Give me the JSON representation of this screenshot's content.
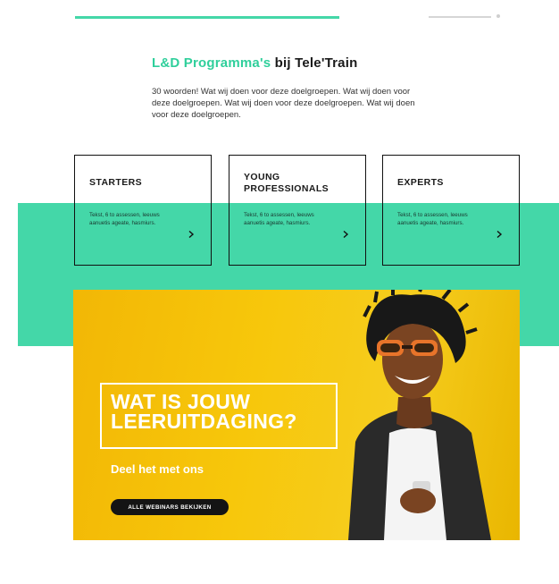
{
  "header": {
    "accent_color": "#44d7a8"
  },
  "section": {
    "title_accent": "L&D Programma's",
    "title_rest": " bij Tele'Train",
    "intro": "30 woorden! Wat wij doen voor deze doelgroepen. Wat wij doen voor deze doelgroepen. Wat wij doen voor deze doelgroepen. Wat wij doen voor deze doelgroepen."
  },
  "cards": [
    {
      "title": "STARTERS",
      "text": "Tekst, 6 to assessen, leeuws aanuetis ageate, hasmiurs.",
      "arrow_icon": "chevron-right-icon"
    },
    {
      "title": "YOUNG PROFESSIONALS",
      "text": "Tekst, 6 to assessen, leeuws aanuetis ageate, hasmiurs.",
      "arrow_icon": "chevron-right-icon"
    },
    {
      "title": "EXPERTS",
      "text": "Tekst, 6 to assessen, leeuws aanuetis ageate, hasmiurs.",
      "arrow_icon": "chevron-right-icon"
    }
  ],
  "hero": {
    "heading": "WAT IS JOUW LEERUITDAGING?",
    "subheading": "Deel het met ons",
    "button_label": "ALLE WEBINARS BEKIJKEN",
    "background_color": "#f4c20d"
  }
}
